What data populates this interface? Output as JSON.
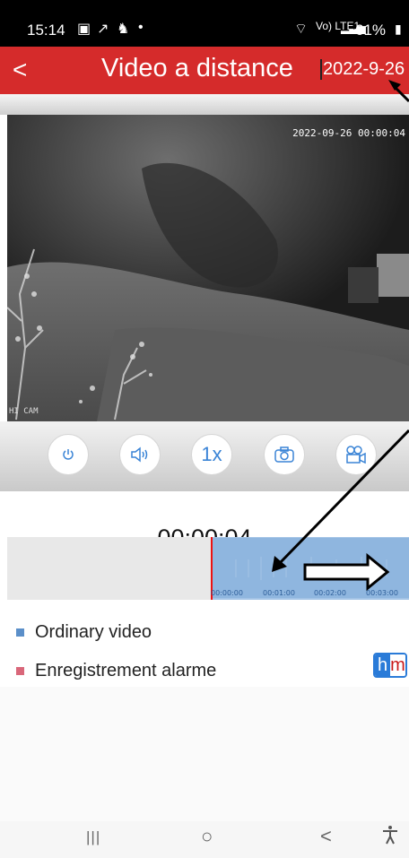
{
  "status_bar": {
    "time": "15:14",
    "network": "Vo) LTE1",
    "battery": "61%",
    "icons": [
      "gallery-icon",
      "missed-call-icon",
      "notification-icon",
      "wifi-icon",
      "signal-icon",
      "battery-icon"
    ]
  },
  "header": {
    "back_label": "<",
    "title": "Video a distance",
    "date": "2022-9-26"
  },
  "video": {
    "timestamp_overlay": "2022-09-26 00:00:04",
    "camera_label": "HI CAM"
  },
  "controls": {
    "power_icon": "power-icon",
    "sound_icon": "speaker-icon",
    "speed_label": "1x",
    "snapshot_icon": "camera-icon",
    "record_icon": "video-record-icon",
    "accent_color": "#3a84d6"
  },
  "playback": {
    "elapsed": "00:00:04"
  },
  "timeline": {
    "labels": [
      "00:00:00",
      "00:01:00",
      "00:02:00",
      "00:03:00"
    ],
    "fill_color": "#8fb6df",
    "cursor_color": "#e11111"
  },
  "legend": {
    "ordinary": "Ordinary video",
    "ordinary_color": "#5b8fc9",
    "alarm": "Enregistrement alarme",
    "alarm_color": "#d9677a"
  },
  "mode_toggle": {
    "h": "h",
    "m": "m"
  },
  "navbar": {
    "recent": "|||",
    "home": "○",
    "back": "<",
    "accessibility": "accessibility-icon"
  },
  "colors": {
    "title_bar": "#d52b2b",
    "status_bar": "#000000"
  }
}
